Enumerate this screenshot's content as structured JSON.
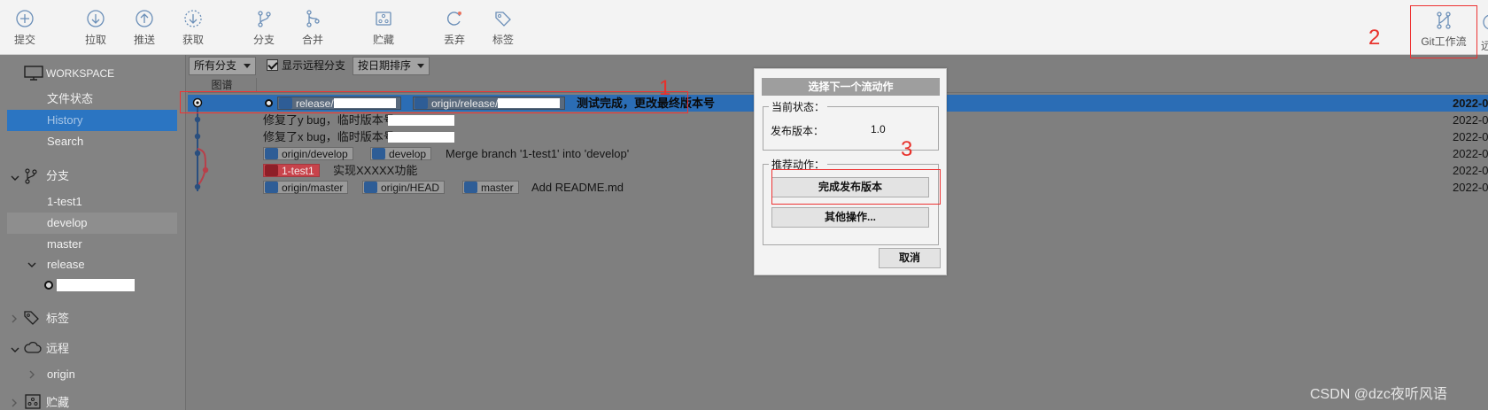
{
  "toolbar": {
    "buttons": [
      {
        "label": "提交",
        "icon": "commit-plus-icon"
      },
      {
        "label": "拉取",
        "icon": "pull-arrow-down-icon"
      },
      {
        "label": "推送",
        "icon": "push-arrow-up-icon"
      },
      {
        "label": "获取",
        "icon": "fetch-arrow-down-icon"
      },
      {
        "label": "分支",
        "icon": "branch-icon"
      },
      {
        "label": "合并",
        "icon": "merge-icon"
      },
      {
        "label": "贮藏",
        "icon": "stash-icon"
      },
      {
        "label": "丢弃",
        "icon": "discard-icon"
      },
      {
        "label": "标签",
        "icon": "tag-icon"
      }
    ],
    "git_flow_label": "Git工作流",
    "edge_partial_label": "远"
  },
  "annotations": {
    "a1": "1",
    "a2": "2",
    "a3": "3"
  },
  "sidebar": {
    "workspace": "WORKSPACE",
    "file_status": "文件状态",
    "history": "History",
    "search": "Search",
    "branches_header": "分支",
    "branches": [
      "1-test1",
      "develop",
      "master"
    ],
    "release_folder": "release",
    "tags_header": "标签",
    "remotes_header": "远程",
    "remote_origin": "origin",
    "stash_header": "贮藏"
  },
  "filters": {
    "branch_filter": "所有分支",
    "show_remote": "显示远程分支",
    "sort_order": "按日期排序"
  },
  "graph_header": "图谱",
  "commits": {
    "row1": {
      "tag1": "release/",
      "tag2": "origin/release/",
      "message": "测试完成，更改最终版本号",
      "date": "2022-0"
    },
    "row2": {
      "message": "修复了y bug，临时版本号",
      "date": "2022-0"
    },
    "row3": {
      "message": "修复了x bug，临时版本号",
      "date": "2022-0"
    },
    "row4": {
      "tag1": "origin/develop",
      "tag2": "develop",
      "message": "Merge branch '1-test1' into 'develop'",
      "date": "2022-0"
    },
    "row5": {
      "tag1": "1-test1",
      "message": "实现XXXXX功能",
      "date": "2022-0"
    },
    "row6": {
      "tag1": "origin/master",
      "tag2": "origin/HEAD",
      "tag3": "master",
      "message": "Add README.md",
      "date": "2022-0"
    }
  },
  "dialog": {
    "title": "选择下一个流动作",
    "current_state": "当前状态：",
    "release_version_label": "发布版本：",
    "release_version_value": "1.0",
    "recommended": "推荐动作：",
    "finish_release": "完成发布版本",
    "other_actions": "其他操作...",
    "cancel": "取消"
  },
  "watermark": "CSDN @dzc夜听风语",
  "colors": {
    "accent": "#2b75c2",
    "annotation": "#e33333",
    "selected_row": "#2b6db5"
  }
}
